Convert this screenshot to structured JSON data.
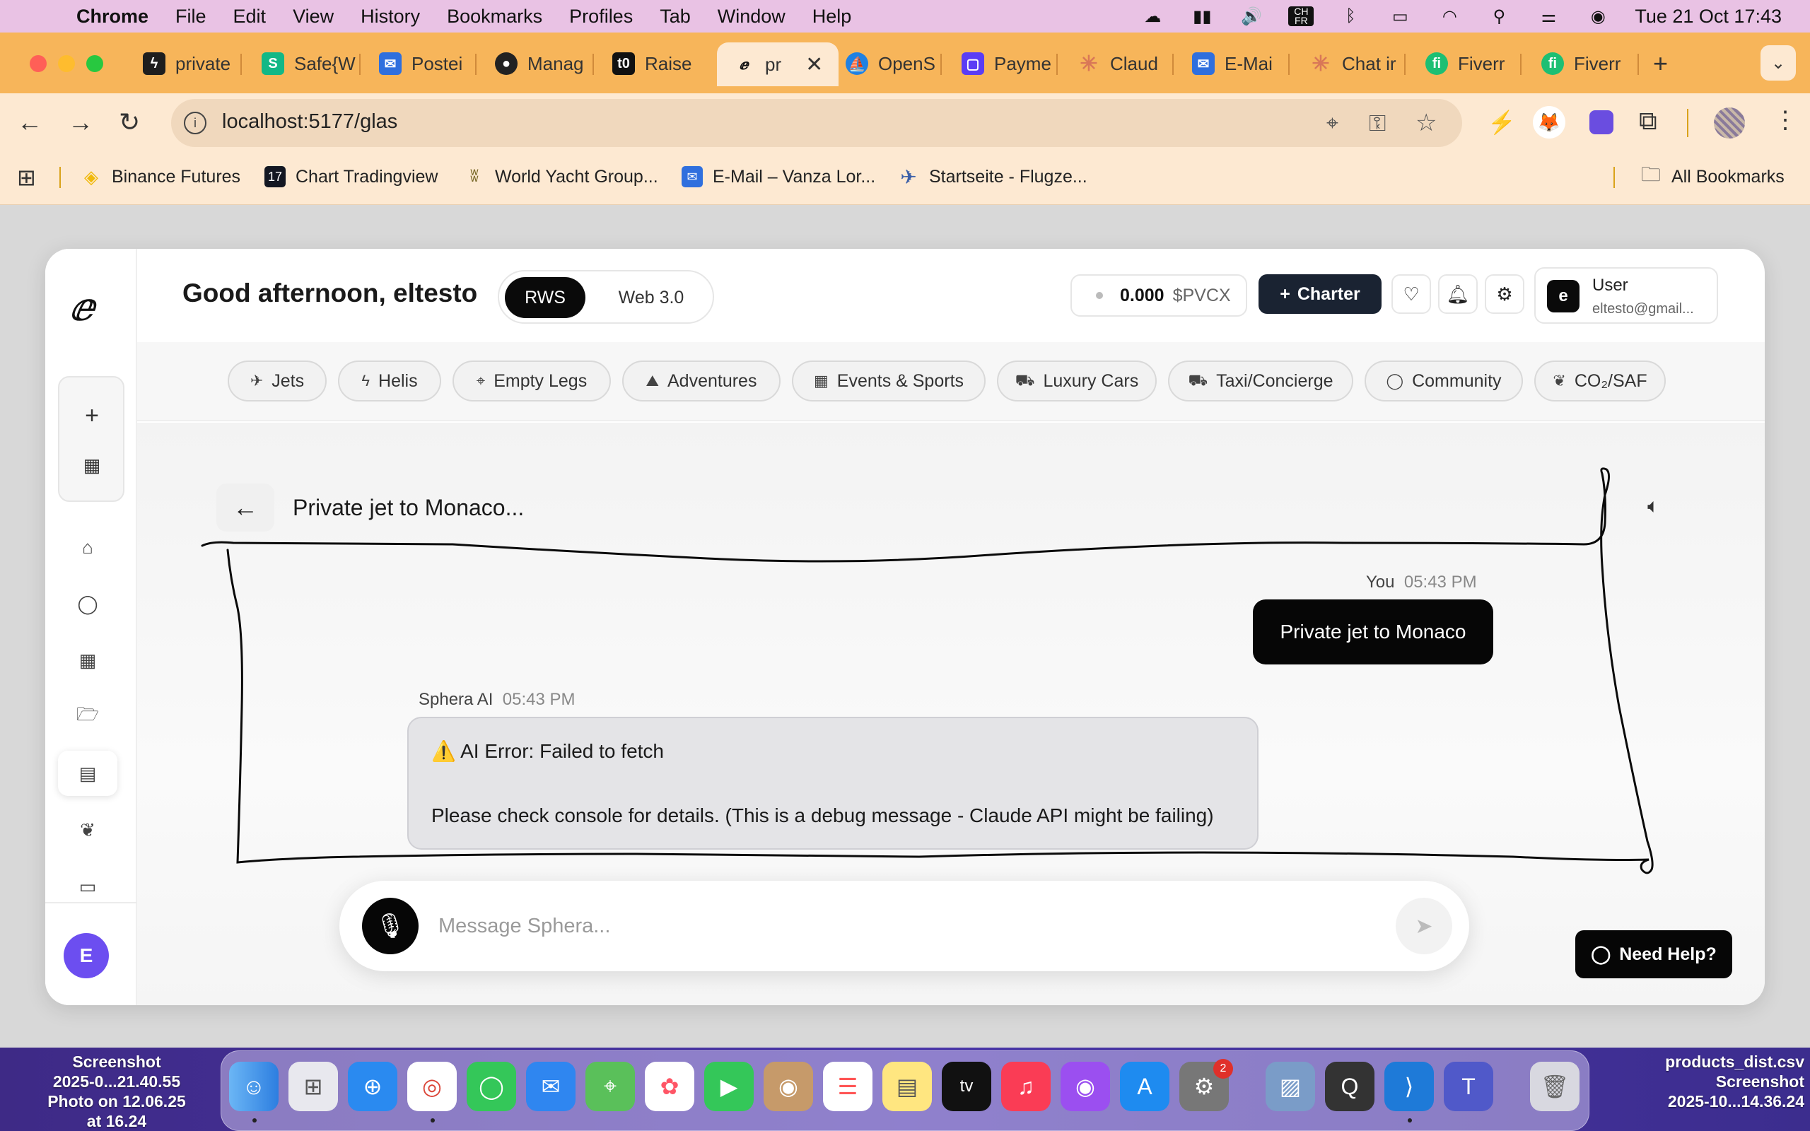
{
  "menubar": {
    "app": "Chrome",
    "items": [
      "File",
      "Edit",
      "View",
      "History",
      "Bookmarks",
      "Profiles",
      "Tab",
      "Window",
      "Help"
    ],
    "datetime": "Tue 21 Oct  17:43",
    "status_icons": [
      "creative-cloud-icon",
      "battery-meter-icon",
      "volume-icon",
      "input-source-icon",
      "bluetooth-icon",
      "battery-icon",
      "wifi-icon",
      "spotlight-icon",
      "control-center-icon",
      "siri-icon"
    ],
    "input_source": "CH FR"
  },
  "tabs": [
    {
      "label": "private",
      "icon": "bolt-icon",
      "color": "#1e1e1e"
    },
    {
      "label": "Safe{W",
      "icon": "safe-icon",
      "color": "#12b886"
    },
    {
      "label": "Postei",
      "icon": "mail-icon",
      "color": "#2f6fde"
    },
    {
      "label": "Manag",
      "icon": "github-icon",
      "color": "#222222"
    },
    {
      "label": "Raise",
      "icon": "raise-icon",
      "color": "#111111"
    },
    {
      "label": "pr",
      "icon": "sphera-icon",
      "color": "#111111",
      "active": true
    },
    {
      "label": "OpenS",
      "icon": "opensea-icon",
      "color": "#2081e2"
    },
    {
      "label": "Payme",
      "icon": "payment-icon",
      "color": "#5b3df5"
    },
    {
      "label": "Claud",
      "icon": "claude-icon",
      "color": "#d97757"
    },
    {
      "label": "E-Mai",
      "icon": "email-icon",
      "color": "#2f6fde"
    },
    {
      "label": "Chat ir",
      "icon": "claude-icon",
      "color": "#d97757"
    },
    {
      "label": "Fiverr",
      "icon": "fiverr-icon",
      "color": "#1dbf73"
    },
    {
      "label": "Fiverr",
      "icon": "fiverr-icon",
      "color": "#1dbf73"
    }
  ],
  "toolbar": {
    "url": "localhost:5177/glas"
  },
  "bookmarks": [
    {
      "label": "Binance Futures",
      "icon": "binance-icon",
      "color": "#f0b90b"
    },
    {
      "label": "Chart Tradingview",
      "icon": "tradingview-icon",
      "color": "#131722"
    },
    {
      "label": "World Yacht Group...",
      "icon": "yacht-icon",
      "color": "#7a6a2a"
    },
    {
      "label": "E-Mail – Vanza Lor...",
      "icon": "email-icon",
      "color": "#2f6fde"
    },
    {
      "label": "Startseite - Flugze...",
      "icon": "plane-icon",
      "color": "#3a5fa8"
    }
  ],
  "all_bookmarks": "All Bookmarks",
  "app": {
    "greeting": "Good afternoon, eltesto",
    "toggle": {
      "active": "RWS",
      "inactive": "Web 3.0"
    },
    "balance": {
      "amount": "0.000",
      "currency": "$PVCX"
    },
    "charter_label": "Charter",
    "user": {
      "initial": "e",
      "name": "User",
      "email": "eltesto@gmail..."
    },
    "avatar_initial": "E",
    "categories": [
      {
        "label": "Jets",
        "icon": "plane-icon"
      },
      {
        "label": "Helis",
        "icon": "bolt-icon"
      },
      {
        "label": "Empty Legs",
        "icon": "pin-icon"
      },
      {
        "label": "Adventures",
        "icon": "mountain-icon"
      },
      {
        "label": "Events & Sports",
        "icon": "calendar-icon"
      },
      {
        "label": "Luxury Cars",
        "icon": "car-icon"
      },
      {
        "label": "Taxi/Concierge",
        "icon": "car-icon"
      },
      {
        "label": "Community",
        "icon": "chat-icon"
      },
      {
        "label": "CO₂/SAF",
        "icon": "leaf-icon"
      }
    ],
    "chat": {
      "title": "Private jet to Monaco...",
      "user_message": {
        "sender": "You",
        "time": "05:43 PM",
        "text": "Private jet to Monaco"
      },
      "ai_message": {
        "sender": "Sphera AI",
        "time": "05:43 PM",
        "line1": "⚠️ AI Error: Failed to fetch",
        "line2": "Please check console for details. (This is a debug message - Claude API might be failing)"
      },
      "input_placeholder": "Message Sphera..."
    },
    "help_label": "Need Help?"
  },
  "desktop": {
    "left_label": "Screenshot\n2025-0...21.40.55\nPhoto on 12.06.25\nat 16.24",
    "right_label": "products_dist.csv\nScreenshot\n2025-10...14.36.24",
    "dock_badge": "2"
  }
}
